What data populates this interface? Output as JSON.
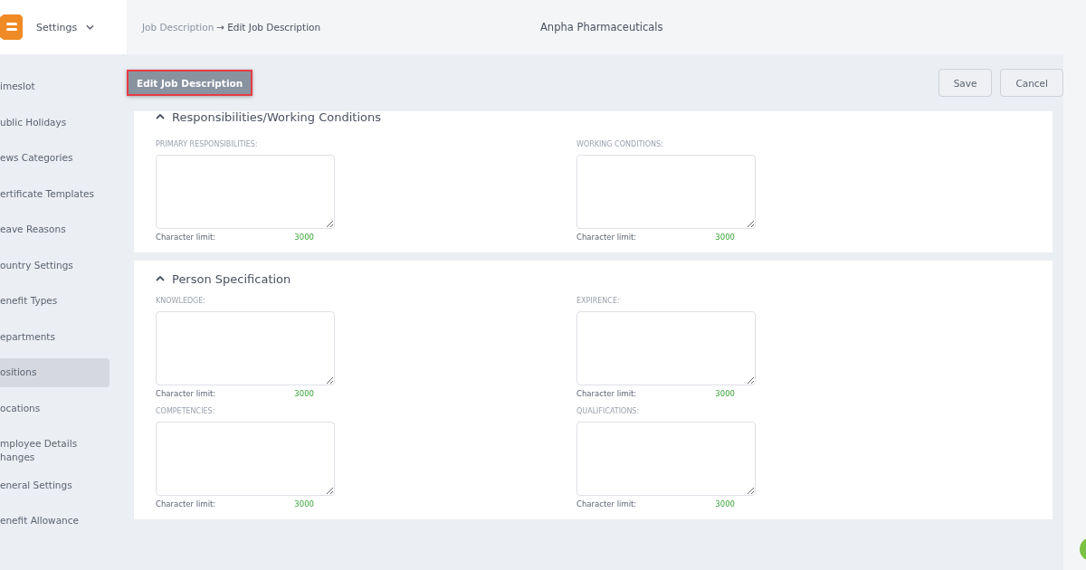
{
  "header": {
    "app_menu": "Settings",
    "breadcrumb": {
      "parent": "Job Description",
      "arrow": "→",
      "current": "Edit Job Description"
    },
    "company": "Anpha Pharmaceuticals"
  },
  "sidebar": {
    "items": [
      {
        "lines": [
          "imeslot"
        ],
        "selected": false
      },
      {
        "lines": [
          "ublic Holidays"
        ],
        "selected": false
      },
      {
        "lines": [
          "ews Categories"
        ],
        "selected": false
      },
      {
        "lines": [
          "ertificate Templates"
        ],
        "selected": false
      },
      {
        "lines": [
          "eave Reasons"
        ],
        "selected": false
      },
      {
        "lines": [
          "ountry Settings"
        ],
        "selected": false
      },
      {
        "lines": [
          "enefit Types"
        ],
        "selected": false
      },
      {
        "lines": [
          "epartments"
        ],
        "selected": false
      },
      {
        "lines": [
          "ositions"
        ],
        "selected": true
      },
      {
        "lines": [
          "ocations"
        ],
        "selected": false
      },
      {
        "lines": [
          "mployee Details",
          "hanges"
        ],
        "selected": false
      },
      {
        "lines": [
          "eneral Settings"
        ],
        "selected": false
      },
      {
        "lines": [
          "enefit Allowance"
        ],
        "selected": false
      }
    ]
  },
  "toolbar": {
    "title_button": "Edit Job Description",
    "buttons": [
      "Save",
      "Cancel"
    ]
  },
  "sections": [
    {
      "title": "Responsibilities/Working Conditions",
      "expanded": true,
      "fields": [
        {
          "label": "PRIMARY RESPONSIBILITIES:",
          "limit_label": "Character limit:",
          "limit": "3000"
        },
        {
          "label": "WORKING CONDITIONS:",
          "limit_label": "Character limit:",
          "limit": "3000"
        }
      ]
    },
    {
      "title": "Person Specification",
      "expanded": true,
      "fields": [
        {
          "label": "KNOWLEDGE:",
          "limit_label": "Character limit:",
          "limit": "3000"
        },
        {
          "label": "EXPIRENCE:",
          "limit_label": "Character limit:",
          "limit": "3000"
        },
        {
          "label": "COMPETENCIES:",
          "limit_label": "Character limit:",
          "limit": "3000"
        },
        {
          "label": "QUALIFICATIONS:",
          "limit_label": "Character limit:",
          "limit": "3000"
        }
      ]
    }
  ]
}
